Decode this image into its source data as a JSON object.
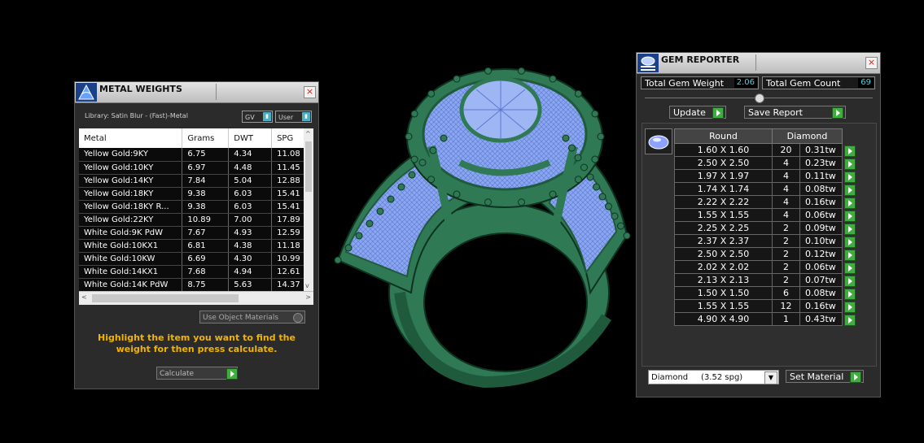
{
  "metal_weights": {
    "title": "METAL WEIGHTS",
    "library_label": "Library: Satin Blur - (Fast)-Metal",
    "dropdown_gv": "GV",
    "dropdown_user": "User",
    "columns": [
      "Metal",
      "Grams",
      "DWT",
      "SPG"
    ],
    "rows": [
      [
        "Yellow Gold:9KY",
        "6.75",
        "4.34",
        "11.08"
      ],
      [
        "Yellow Gold:10KY",
        "6.97",
        "4.48",
        "11.45"
      ],
      [
        "Yellow Gold:14KY",
        "7.84",
        "5.04",
        "12.88"
      ],
      [
        "Yellow Gold:18KY",
        "9.38",
        "6.03",
        "15.41"
      ],
      [
        "Yellow Gold:18KY R...",
        "9.38",
        "6.03",
        "15.41"
      ],
      [
        "Yellow Gold:22KY",
        "10.89",
        "7.00",
        "17.89"
      ],
      [
        "White Gold:9K PdW",
        "7.67",
        "4.93",
        "12.59"
      ],
      [
        "White Gold:10KX1",
        "6.81",
        "4.38",
        "11.18"
      ],
      [
        "White Gold:10KW",
        "6.69",
        "4.30",
        "10.99"
      ],
      [
        "White Gold:14KX1",
        "7.68",
        "4.94",
        "12.61"
      ],
      [
        "White Gold:14K PdW",
        "8.75",
        "5.63",
        "14.37"
      ]
    ],
    "use_object_materials": "Use Object Materials",
    "hint": "Highlight the item you want to find the weight for then press calculate.",
    "calculate_label": "Calculate"
  },
  "gem_reporter": {
    "title": "GEM REPORTER",
    "total_gem_weight_label": "Total Gem Weight",
    "total_gem_weight": "2.06",
    "total_gem_count_label": "Total Gem Count",
    "total_gem_count": "69",
    "update_label": "Update",
    "save_report_label": "Save Report",
    "table_headers": [
      "Round",
      "Diamond"
    ],
    "rows": [
      [
        "1.60 X 1.60",
        "20",
        "0.31tw"
      ],
      [
        "2.50 X 2.50",
        "4",
        "0.23tw"
      ],
      [
        "1.97 X 1.97",
        "4",
        "0.11tw"
      ],
      [
        "1.74 X 1.74",
        "4",
        "0.08tw"
      ],
      [
        "2.22 X 2.22",
        "4",
        "0.16tw"
      ],
      [
        "1.55 X 1.55",
        "4",
        "0.06tw"
      ],
      [
        "2.25 X 2.25",
        "2",
        "0.09tw"
      ],
      [
        "2.37 X 2.37",
        "2",
        "0.10tw"
      ],
      [
        "2.50 X 2.50",
        "2",
        "0.12tw"
      ],
      [
        "2.02 X 2.02",
        "2",
        "0.06tw"
      ],
      [
        "2.13 X 2.13",
        "2",
        "0.07tw"
      ],
      [
        "1.50 X 1.50",
        "6",
        "0.08tw"
      ],
      [
        "1.55 X 1.55",
        "12",
        "0.16tw"
      ],
      [
        "4.90 X 4.90",
        "1",
        "0.43tw"
      ]
    ],
    "material_select": "Diamond     (3.52 spg)",
    "set_material_label": "Set Material"
  },
  "viewport": {
    "colors": {
      "metal": "#2f7a55",
      "metal_dark": "#1f5a3c",
      "gem": "#8aa6f0",
      "gem_line": "#5c78cf"
    }
  },
  "colors": {
    "hint": "#f0b400",
    "go_button": "#3fae3f",
    "value_text": "#4ad4e8"
  }
}
